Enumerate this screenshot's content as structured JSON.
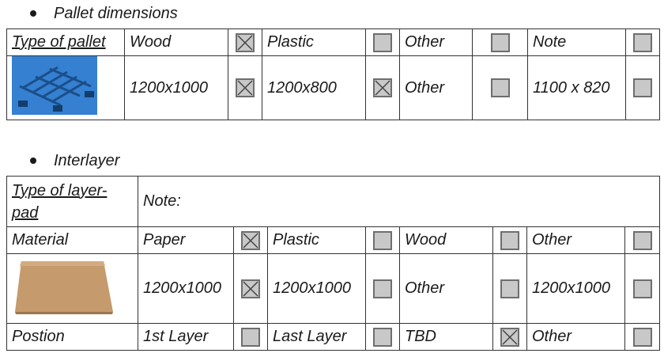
{
  "pallet_section": {
    "heading": "Pallet dimensions",
    "header_row": {
      "label": "Type of pallet",
      "options": [
        {
          "text": "Wood",
          "checked": true
        },
        {
          "text": "Plastic",
          "checked": false
        },
        {
          "text": "Other",
          "checked": false
        },
        {
          "text": "Note",
          "checked": false
        }
      ]
    },
    "size_row": {
      "image_icon": "wooden-pallet-image",
      "options": [
        {
          "text": "1200x1000",
          "checked": true
        },
        {
          "text": "1200x800",
          "checked": true
        },
        {
          "text": "Other",
          "checked": false
        },
        {
          "text": "1100 x 820",
          "checked": false
        }
      ]
    }
  },
  "interlayer_section": {
    "heading": "Interlayer",
    "type_row": {
      "label": "Type of layer-pad",
      "note": "Note:"
    },
    "material_row": {
      "label": "Material",
      "options": [
        {
          "text": "Paper",
          "checked": true
        },
        {
          "text": "Plastic",
          "checked": false
        },
        {
          "text": "Wood",
          "checked": false
        },
        {
          "text": "Other",
          "checked": false
        }
      ]
    },
    "size_row": {
      "image_icon": "cardboard-pad-image",
      "options": [
        {
          "text": "1200x1000",
          "checked": true
        },
        {
          "text": "1200x1000",
          "checked": false
        },
        {
          "text": "Other",
          "checked": false
        },
        {
          "text": "1200x1000",
          "checked": false
        }
      ]
    },
    "position_row": {
      "label": "Postion",
      "options": [
        {
          "text": "1st Layer",
          "checked": false
        },
        {
          "text": "Last Layer",
          "checked": false
        },
        {
          "text": "TBD",
          "checked": true
        },
        {
          "text": "Other",
          "checked": false
        }
      ]
    }
  }
}
